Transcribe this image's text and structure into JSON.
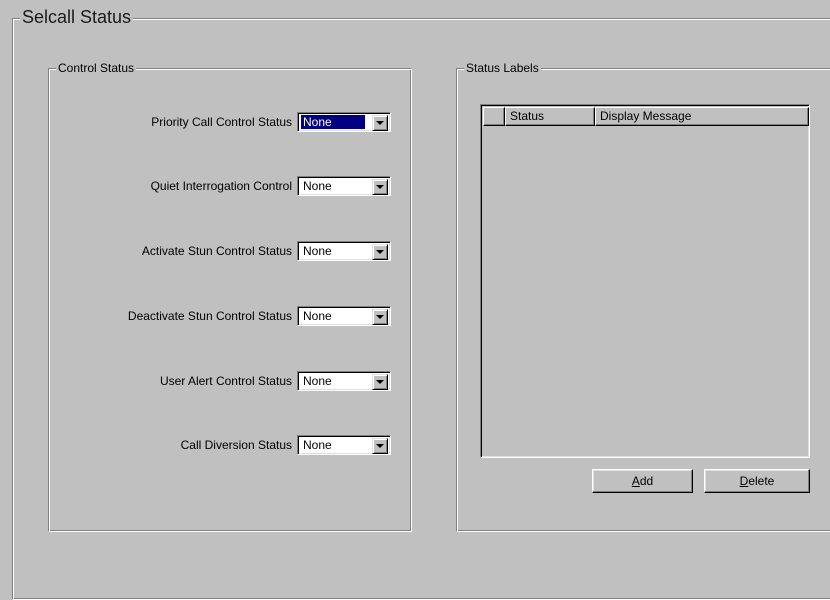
{
  "window": {
    "title": "Selcall Status"
  },
  "control_status": {
    "title": "Control Status",
    "fields": [
      {
        "label": "Priority Call Control Status",
        "value": "None"
      },
      {
        "label": "Quiet Interrogation Control",
        "value": "None"
      },
      {
        "label": "Activate Stun Control Status",
        "value": "None"
      },
      {
        "label": "Deactivate Stun Control Status",
        "value": "None"
      },
      {
        "label": "User Alert Control Status",
        "value": "None"
      },
      {
        "label": "Call Diversion Status",
        "value": "None"
      }
    ]
  },
  "status_labels": {
    "title": "Status Labels",
    "columns": [
      "",
      "Status",
      "Display Message"
    ],
    "rows": [],
    "add_label": {
      "mnemonic": "A",
      "rest": "dd"
    },
    "delete_label": {
      "mnemonic": "D",
      "rest": "elete"
    }
  },
  "colors": {
    "face": "#c0c0c0",
    "selection": "#000080"
  },
  "icons": {
    "combo_arrow": "chevron-down-icon"
  }
}
